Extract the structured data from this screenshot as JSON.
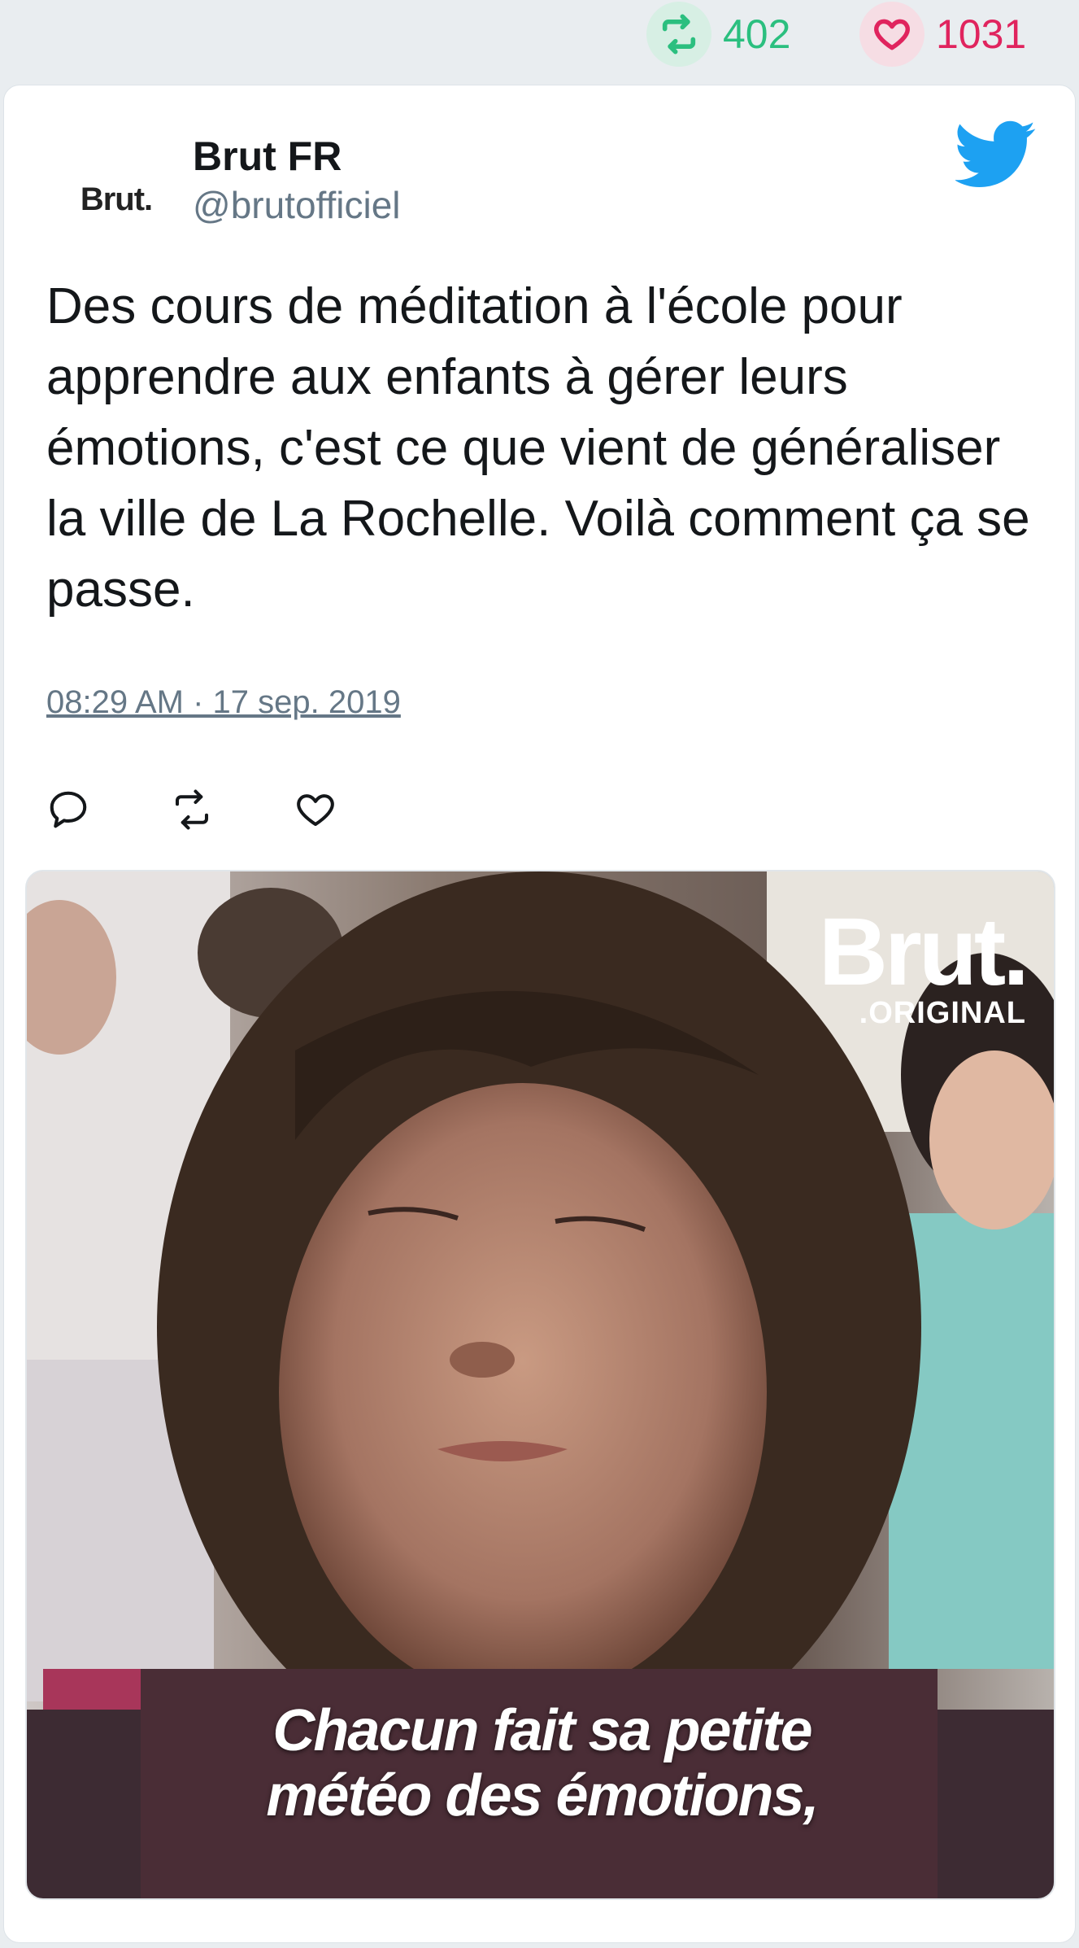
{
  "stats": {
    "retweets": "402",
    "likes": "1031"
  },
  "tweet": {
    "avatar_text": "Brut.",
    "author_name": "Brut FR",
    "author_handle": "@brutofficiel",
    "text": "Des cours de méditation à l'école pour apprendre aux enfants à gérer leurs émotions, c'est ce que vient de généraliser la ville de La Rochelle. Voilà comment ça se passe.",
    "timestamp": "08:29 AM · 17 sep. 2019"
  },
  "media": {
    "logo_main": "Brut.",
    "logo_sub": ".ORIGINAL",
    "caption_line1": "Chacun fait sa petite",
    "caption_line2": "météo des émotions,"
  },
  "icons": {
    "retweet": "retweet-icon",
    "like": "heart-icon",
    "reply": "reply-icon",
    "twitter": "twitter-bird-icon"
  },
  "colors": {
    "retweet": "#2bbf7f",
    "like": "#e0245e",
    "twitter_blue": "#1da1f2",
    "muted": "#657786"
  }
}
